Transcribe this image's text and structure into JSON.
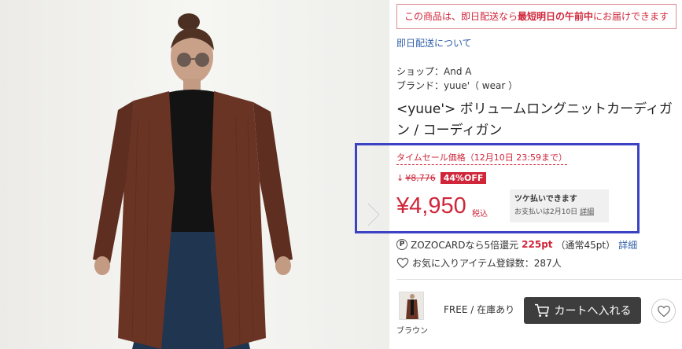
{
  "notice": {
    "prefix": "この商品は、即日配送なら",
    "bold": "最短明日の午前中",
    "suffix": "にお届けできます"
  },
  "sameday_link": "即日配送について",
  "shop": "ショップ：And A",
  "brand": "ブランド：yuue'（ wear ）",
  "title": "<yuue'> ボリュームロングニットカーディガン / コーディガン",
  "sale_label": "タイムセール価格（12月10日 23:59まで）",
  "down_arrow": "↓",
  "old_price": "¥8,776",
  "off_badge": "44%OFF",
  "price": "¥4,950",
  "tax": "税込",
  "tsuke": {
    "title": "ツケ払いできます",
    "sub": "お支払いは2月10日",
    "detail": "詳細"
  },
  "points": {
    "icon": "P",
    "text": "ZOZOCARDなら5倍還元",
    "strong": "225pt",
    "normal": "（通常45pt）",
    "detail": "詳細"
  },
  "fav": {
    "text": "お気に入りアイテム登録数：287人"
  },
  "variant": {
    "color_label": "ブラウン",
    "stock": "FREE / 在庫あり",
    "cart_label": "カートへ入れる"
  },
  "colors": {
    "accent_red": "#d0263a",
    "link_blue": "#2f5fa8",
    "highlight_blue": "#3b42c4",
    "cart_dark": "#3d3d3d"
  },
  "icons": {
    "next": "chevron-right-icon",
    "points": "points-p-icon",
    "fav": "heart-outline-icon",
    "cart": "cart-icon",
    "heart_button": "heart-outline-icon"
  }
}
